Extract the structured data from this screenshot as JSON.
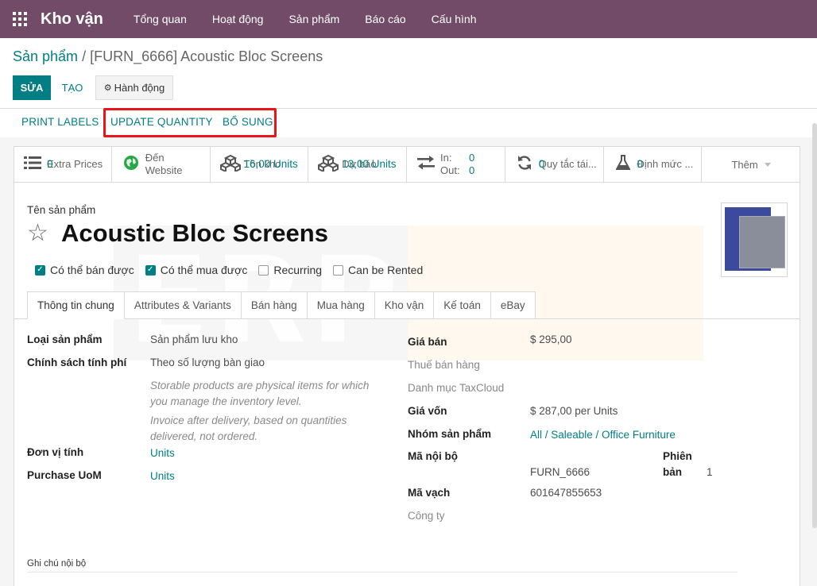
{
  "nav": {
    "brand": "Kho vận",
    "items": [
      "Tổng quan",
      "Hoạt động",
      "Sản phẩm",
      "Báo cáo",
      "Cấu hình"
    ]
  },
  "breadcrumb": {
    "parent": "Sản phẩm",
    "separator": " / ",
    "current": "[FURN_6666] Acoustic Bloc Screens"
  },
  "toolbar": {
    "edit_label": "SỬA",
    "create_label": "TẠO",
    "action_label": "Hành động"
  },
  "header_buttons": {
    "print_labels": "PRINT LABELS",
    "update_quantity": "UPDATE QUANTITY",
    "replenish": "BỔ SUNG"
  },
  "smart_buttons": [
    {
      "value": "0",
      "label": "Extra Prices",
      "icon": "list-icon"
    },
    {
      "value": "Đến",
      "label": "Website",
      "icon": "globe-icon"
    },
    {
      "value": "16,00 Units",
      "label": "Tồn kho",
      "icon": "cubes-icon"
    },
    {
      "value": "13,00 Units",
      "label": "Dự báo",
      "icon": "cubes-icon"
    },
    {
      "in_label": "In:",
      "in_value": "0",
      "out_label": "Out:",
      "out_value": "0",
      "icon": "exchange-icon"
    },
    {
      "value": "0",
      "label": "Quy tắc tái...",
      "icon": "refresh-icon"
    },
    {
      "value": "0",
      "label": "Định mức ...",
      "icon": "flask-icon"
    }
  ],
  "more_label": "Thêm",
  "watermark": "ERP One",
  "product": {
    "name_caption": "Tên sản phẩm",
    "name": "Acoustic Bloc Screens"
  },
  "checkboxes": [
    {
      "label": "Có thể bán được",
      "checked": true
    },
    {
      "label": "Có thể mua được",
      "checked": true
    },
    {
      "label": "Recurring",
      "checked": false
    },
    {
      "label": "Can be Rented",
      "checked": false
    }
  ],
  "tabs": [
    "Thông tin chung",
    "Attributes & Variants",
    "Bán hàng",
    "Mua hàng",
    "Kho vận",
    "Kế toán",
    "eBay"
  ],
  "general": {
    "product_type_label": "Loại sản phẩm",
    "product_type": "Sản phẩm lưu kho",
    "invoice_policy_label": "Chính sách tính phí",
    "invoice_policy": "Theo số lượng bàn giao",
    "help_storable": "Storable products are physical items for which you manage the inventory level.",
    "help_invoice": "Invoice after delivery, based on quantities delivered, not ordered.",
    "uom_label": "Đơn vị tính",
    "uom": "Units",
    "purchase_uom_label": "Purchase UoM",
    "purchase_uom": "Units",
    "sale_price_label": "Giá bán",
    "sale_price": "$ 295,00",
    "sale_tax_label": "Thuế bán hàng",
    "taxcloud_label": "Danh mục TaxCloud",
    "cost_label": "Giá vốn",
    "cost": "$ 287,00  per Units",
    "category_label": "Nhóm sản phẩm",
    "category": "All / Saleable / Office Furniture",
    "ref_label": "Mã nội bộ",
    "ref": "FURN_6666",
    "version_label_1": "Phiên",
    "version_label_2": "bản",
    "version": "1",
    "barcode_label": "Mã vạch",
    "barcode": "601647855653",
    "company_label": "Công ty"
  },
  "note_label": "Ghi chú nội bộ",
  "colors": {
    "brand": "#714b67",
    "accent": "#017e84",
    "highlight": "#e8151b"
  }
}
